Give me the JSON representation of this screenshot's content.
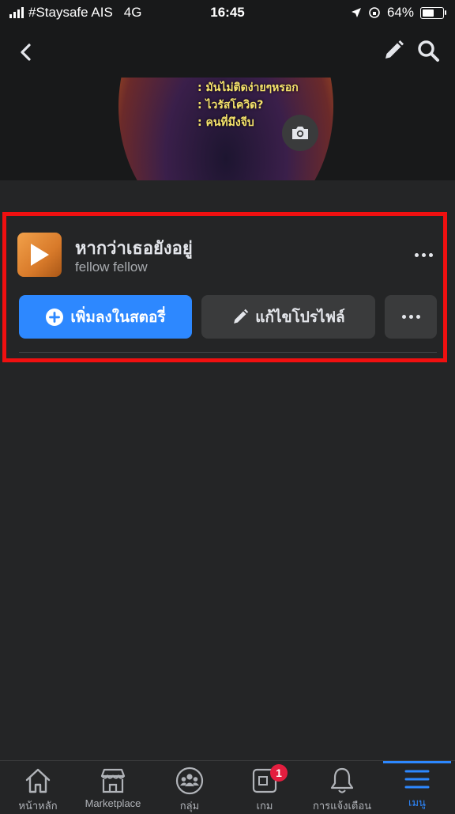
{
  "status_bar": {
    "carrier": "#Staysafe AIS",
    "network": "4G",
    "time": "16:45",
    "battery": "64%",
    "battery_level": 0.64
  },
  "cover": {
    "text_lines": [
      ": มันไม่ติดง่ายๆหรอก",
      ": ไวรัสโควิด?",
      ": คนที่มึงจีบ"
    ]
  },
  "page": {
    "name": "หากว่าเธอยังอยู่",
    "handle": "fellow fellow"
  },
  "actions": {
    "add_story": "เพิ่มลงในสตอรี่",
    "edit_profile": "แก้ไขโปรไฟล์"
  },
  "bottom_nav": {
    "items": [
      {
        "label": "หน้าหลัก",
        "icon": "home-icon"
      },
      {
        "label": "Marketplace",
        "icon": "marketplace-icon"
      },
      {
        "label": "กลุ่ม",
        "icon": "groups-icon"
      },
      {
        "label": "เกม",
        "icon": "gaming-icon",
        "badge": "1"
      },
      {
        "label": "การแจ้งเตือน",
        "icon": "bell-icon"
      },
      {
        "label": "เมนู",
        "icon": "menu-icon",
        "active": true
      }
    ]
  },
  "colors": {
    "background": "#242526",
    "primary": "#2d88ff",
    "highlight": "#f01010",
    "badge": "#e41e3f"
  }
}
